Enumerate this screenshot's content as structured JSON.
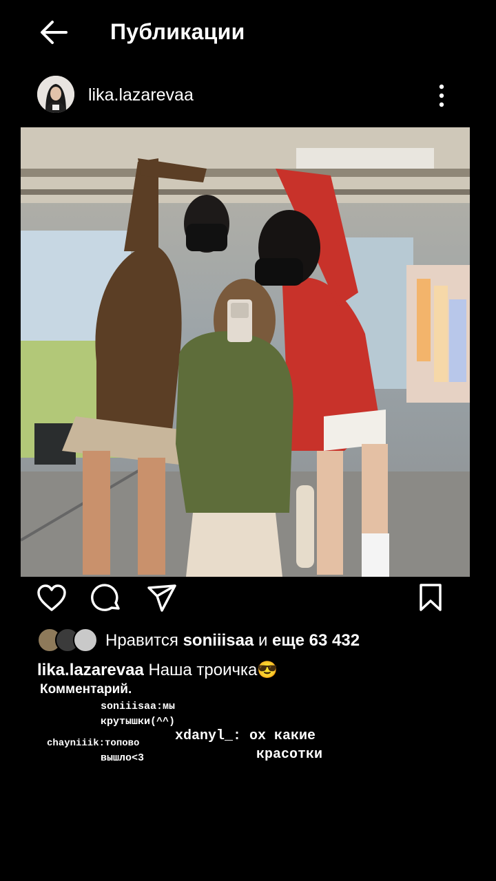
{
  "header": {
    "title": "Публикации",
    "back_icon": "arrow-left-icon"
  },
  "post": {
    "author": "lika.lazarevaa",
    "more_icon": "more-vertical-icon",
    "photo_description_icon": "photo",
    "actions": {
      "like_icon": "heart-icon",
      "comment_icon": "comment-bubble-icon",
      "share_icon": "paper-plane-icon",
      "save_icon": "bookmark-icon"
    },
    "likes": {
      "prefix": "Нравится",
      "user": "soniiisaa",
      "connector": "и",
      "rest": "еще 63 432"
    },
    "caption": {
      "user": "lika.lazarevaa",
      "text": "Наша троичка",
      "emoji": "😎"
    }
  },
  "comments": {
    "label": "Комментарий.",
    "items": [
      {
        "line1": "soniiisaa:мы",
        "line2": "крутышки(^^)"
      },
      {
        "line1": "chayniiik:топово",
        "line2": "вышло<3"
      },
      {
        "line1": "xdanyl_: ох какие",
        "line2": "красотки"
      }
    ]
  },
  "colors": {
    "background": "#000000",
    "text": "#ffffff"
  }
}
